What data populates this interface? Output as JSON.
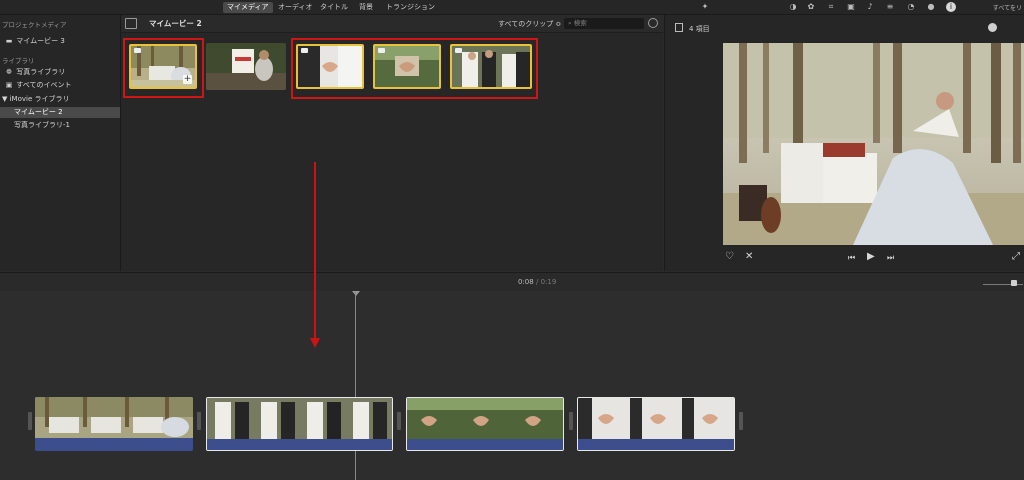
{
  "top_tabs": [
    "マイメディア",
    "オーディオ",
    "タイトル",
    "背景",
    "トランジション"
  ],
  "active_tab": "マイメディア",
  "right_toolbar": {
    "label": "すべてをリ"
  },
  "sidebar": {
    "project_media_header": "プロジェクトメディア",
    "project_item": "マイムービー 3",
    "library_header": "ライブラリ",
    "items": [
      "写真ライブラリ",
      "すべてのイベント"
    ],
    "imovie_library": "▼ iMovie ライブラリ",
    "events": [
      "マイムービー 2",
      "写真ライブラリ-1"
    ],
    "selected_event": "マイムービー 2"
  },
  "browser": {
    "title": "マイムービー 2",
    "filter": "すべてのクリップ ≎",
    "search_placeholder": "検索"
  },
  "viewer": {
    "item_count": "4 項目"
  },
  "timeline": {
    "current_time": "0:08",
    "separator": "/",
    "total_time": "0:19"
  },
  "colors": {
    "selection": "#e8c23a",
    "annotation": "#d01515",
    "audio_track": "#3d4e8d"
  }
}
